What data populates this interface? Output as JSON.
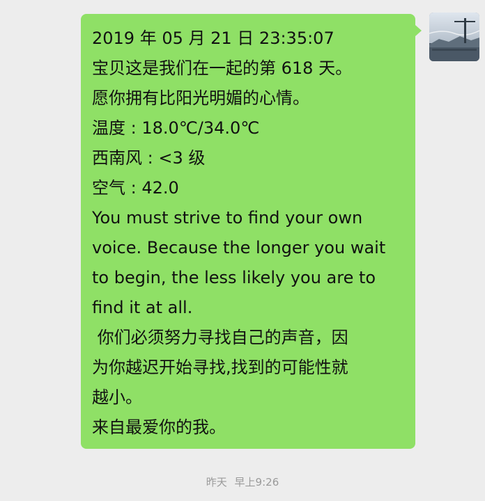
{
  "message": {
    "lines": [
      "2019 年 05 月 21 日 23:35:07",
      "宝贝这是我们在一起的第 618 天。",
      "愿你拥有比阳光明媚的心情。",
      "温度 : 18.0℃/34.0℃",
      "西南风 : <3 级",
      "空气 : 42.0",
      "You must strive to find your own",
      "voice. Because the longer you wait",
      "to begin, the less likely you are to",
      "find it at all.",
      " 你们必须努力寻找自己的声音，因",
      "为你越迟开始寻找,找到的可能性就",
      "越小。",
      "来自最爱你的我。"
    ]
  },
  "timestamp": {
    "day": "昨天",
    "time": "早上9:26"
  },
  "colors": {
    "bubble": "#8fe066",
    "background": "#ededed",
    "timestamp_text": "#9a9a9a"
  },
  "avatar": {
    "icon": "avatar-photo-icon"
  }
}
